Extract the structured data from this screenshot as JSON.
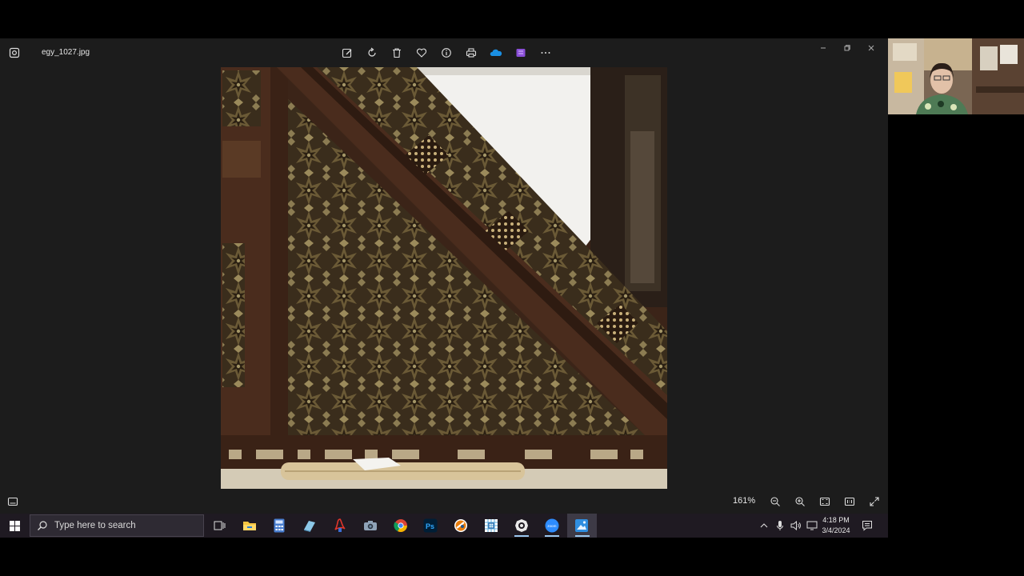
{
  "photos_app": {
    "file_name": "egy_1027.jpg",
    "toolbar": [
      {
        "name": "edit-image-icon",
        "label": "Edit image"
      },
      {
        "name": "rotate-icon",
        "label": "Rotate"
      },
      {
        "name": "delete-icon",
        "label": "Delete"
      },
      {
        "name": "favorite-icon",
        "label": "Favorite"
      },
      {
        "name": "info-icon",
        "label": "File info"
      },
      {
        "name": "print-icon",
        "label": "Print"
      },
      {
        "name": "onedrive-icon",
        "label": "OneDrive"
      },
      {
        "name": "clipchamp-icon",
        "label": "Clipchamp"
      },
      {
        "name": "more-icon",
        "label": "See more"
      }
    ],
    "zoom_level": "161%",
    "image_subject": "minbar-geometric-panel"
  },
  "taskbar": {
    "search_placeholder": "Type here to search",
    "apps": [
      "task-view-icon",
      "file-explorer-icon",
      "calculator-icon",
      "notepad-icon",
      "acrobat-icon",
      "camera-icon",
      "chrome-icon",
      "photoshop-icon",
      "blender-icon",
      "snipping-icon",
      "settings-icon",
      "zoom-icon",
      "photos-icon"
    ],
    "time": "4:18 PM",
    "date": "3/4/2024"
  },
  "colors": {
    "window_bg": "#1c1c1c",
    "taskbar_bg": "#1f1a22",
    "accent": "#9ac7ef"
  }
}
